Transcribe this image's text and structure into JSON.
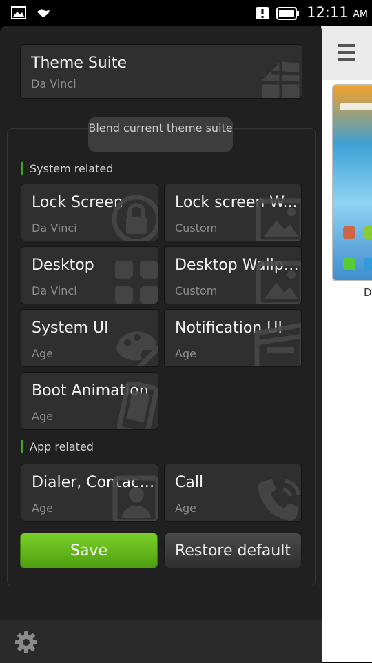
{
  "status_bar": {
    "time": "12:11",
    "ampm": "AM"
  },
  "background": {
    "caption": "D"
  },
  "theme_suite": {
    "title": "Theme Suite",
    "value": "Da Vinci"
  },
  "blend_label": "Blend current theme suite",
  "system_section": "System related",
  "app_section": "App related",
  "cards": [
    {
      "title": "Lock Screen",
      "value": "Da Vinci",
      "icon": "lock-icon"
    },
    {
      "title": "Lock screen W...",
      "value": "Custom",
      "icon": "image-icon"
    },
    {
      "title": "Desktop",
      "value": "Da Vinci",
      "icon": "flower-icon"
    },
    {
      "title": "Desktop Wallpa...",
      "value": "Custom",
      "icon": "image-icon"
    },
    {
      "title": "System UI",
      "value": "Age",
      "icon": "palette-icon"
    },
    {
      "title": "Notification UI",
      "value": "Age",
      "icon": "notification-icon"
    },
    {
      "title": "Boot Animation",
      "value": "Age",
      "icon": "phone-device-icon"
    },
    {
      "title": "Dialer, Contacts...",
      "value": "Age",
      "icon": "contact-icon"
    },
    {
      "title": "Call",
      "value": "Age",
      "icon": "call-icon"
    }
  ],
  "buttons": {
    "save": "Save",
    "restore": "Restore default"
  },
  "bottom_bar": {
    "settings_icon": "gear-icon"
  }
}
